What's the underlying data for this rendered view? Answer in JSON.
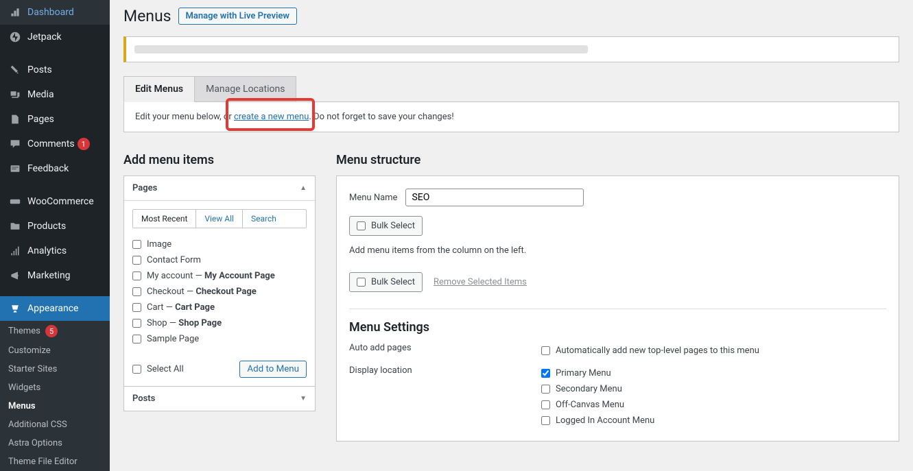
{
  "sidebar": {
    "items": [
      {
        "label": "Dashboard",
        "icon": "dashboard"
      },
      {
        "label": "Jetpack",
        "icon": "jetpack"
      },
      {
        "label": "Posts",
        "icon": "posts"
      },
      {
        "label": "Media",
        "icon": "media"
      },
      {
        "label": "Pages",
        "icon": "pages"
      },
      {
        "label": "Comments",
        "icon": "comments",
        "badge": "1"
      },
      {
        "label": "Feedback",
        "icon": "feedback"
      },
      {
        "label": "WooCommerce",
        "icon": "woo"
      },
      {
        "label": "Products",
        "icon": "products"
      },
      {
        "label": "Analytics",
        "icon": "analytics"
      },
      {
        "label": "Marketing",
        "icon": "marketing"
      },
      {
        "label": "Appearance",
        "icon": "appearance",
        "active": true
      }
    ],
    "sub": [
      {
        "label": "Themes",
        "badge": "5"
      },
      {
        "label": "Customize"
      },
      {
        "label": "Starter Sites"
      },
      {
        "label": "Widgets"
      },
      {
        "label": "Menus",
        "active": true
      },
      {
        "label": "Additional CSS"
      },
      {
        "label": "Astra Options"
      },
      {
        "label": "Theme File Editor"
      }
    ]
  },
  "header": {
    "title": "Menus",
    "preview_btn": "Manage with Live Preview"
  },
  "tabs": [
    {
      "label": "Edit Menus",
      "active": true
    },
    {
      "label": "Manage Locations"
    }
  ],
  "instruction": {
    "pre": "Edit your menu below, or ",
    "link": "create a new menu",
    "post": ". Do not forget to save your changes!"
  },
  "left_col": {
    "title": "Add menu items",
    "pages": {
      "title": "Pages",
      "subtabs": [
        {
          "label": "Most Recent",
          "active": true
        },
        {
          "label": "View All"
        },
        {
          "label": "Search"
        }
      ],
      "items": [
        {
          "label": "Image"
        },
        {
          "label": "Contact Form"
        },
        {
          "label": "My account",
          "suffix": "My Account Page"
        },
        {
          "label": "Checkout",
          "suffix": "Checkout Page"
        },
        {
          "label": "Cart",
          "suffix": "Cart Page"
        },
        {
          "label": "Shop",
          "suffix": "Shop Page"
        },
        {
          "label": "Sample Page"
        }
      ],
      "select_all": "Select All",
      "add_btn": "Add to Menu"
    },
    "posts": {
      "title": "Posts"
    }
  },
  "right_col": {
    "title": "Menu structure",
    "menu_name_label": "Menu Name",
    "menu_name_value": "SEO",
    "bulk_select": "Bulk Select",
    "hint": "Add menu items from the column on the left.",
    "remove_link": "Remove Selected Items",
    "settings_title": "Menu Settings",
    "auto_add_label": "Auto add pages",
    "auto_add_option": "Automatically add new top-level pages to this menu",
    "display_label": "Display location",
    "locations": [
      {
        "label": "Primary Menu",
        "checked": true
      },
      {
        "label": "Secondary Menu"
      },
      {
        "label": "Off-Canvas Menu"
      },
      {
        "label": "Logged In Account Menu"
      }
    ]
  }
}
